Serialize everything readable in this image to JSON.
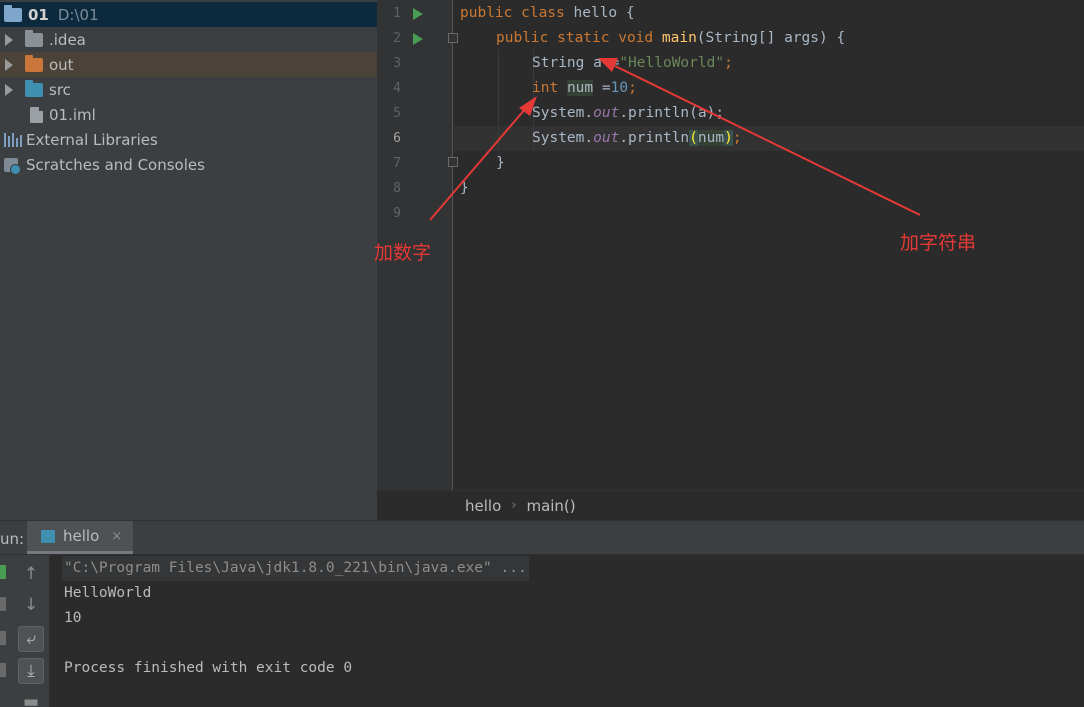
{
  "project": {
    "root_name": "01",
    "root_path": "D:\\01",
    "items": [
      {
        "label": ".idea"
      },
      {
        "label": "out"
      },
      {
        "label": "src"
      },
      {
        "label": "01.iml"
      },
      {
        "label": "External Libraries"
      },
      {
        "label": "Scratches and Consoles"
      }
    ]
  },
  "editor": {
    "line_numbers": [
      "1",
      "2",
      "3",
      "4",
      "5",
      "6",
      "7",
      "8",
      "9"
    ],
    "code": {
      "l1_kw": "public class ",
      "l1_rest": "hello {",
      "l2_kw": "public static void ",
      "l2_fn": "main",
      "l2_rest": "(String[] args) {",
      "l3_a": "String ",
      "l3_var": "a",
      "l3_eq": " =",
      "l3_str": "\"HelloWorld\"",
      "l3_semi": ";",
      "l4_kw": "int",
      "l4_sp": " ",
      "l4_var": "num",
      "l4_eq": " =",
      "l4_num": "10",
      "l4_semi": ";",
      "l5_sys": "System.",
      "l5_out": "out",
      "l5_rest": ".println(a);",
      "l6_sys": "System.",
      "l6_out": "out",
      "l6_mid": ".println",
      "l6_lp": "(",
      "l6_arg": "num",
      "l6_rp": ")",
      "l6_semi": ";",
      "l7": "}",
      "l8": "}"
    }
  },
  "breadcrumb": {
    "class": "hello",
    "method": "main()"
  },
  "run_panel": {
    "label": "un:",
    "tab_label": "hello",
    "tab_close": "×",
    "output": [
      "\"C:\\Program Files\\Java\\jdk1.8.0_221\\bin\\java.exe\" ...",
      "HelloWorld",
      "10",
      "",
      "Process finished with exit code 0"
    ]
  },
  "annotations": {
    "number_label": "加数字",
    "string_label": "加字符串",
    "color": "#e53935"
  },
  "colors": {
    "keyword": "#cc7832",
    "function": "#ffc66d",
    "string": "#6a8759",
    "number": "#6897bb",
    "field": "#9876aa"
  }
}
